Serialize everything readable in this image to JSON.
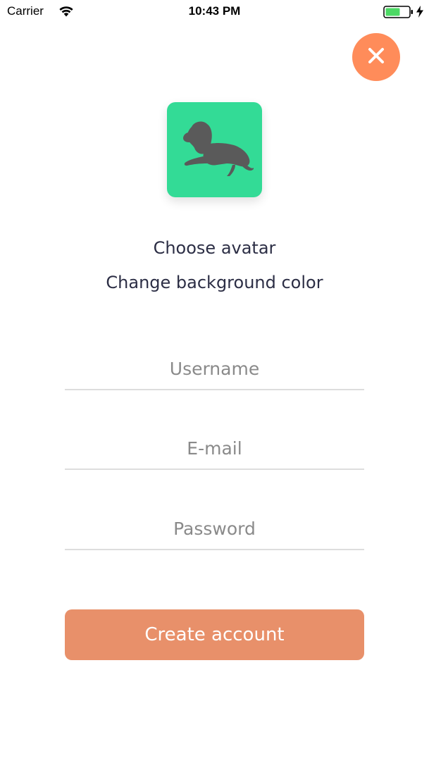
{
  "status_bar": {
    "carrier": "Carrier",
    "time": "10:43 PM",
    "icons": [
      "wifi-icon",
      "battery-icon",
      "charging-icon"
    ],
    "battery_color": "#4cd964"
  },
  "close": {
    "icon": "close-icon",
    "color": "#ff8c5a"
  },
  "avatar": {
    "icon": "lion-icon",
    "background_color": "#33db96",
    "figure_color": "#5a5a5a"
  },
  "links": {
    "choose_avatar": "Choose avatar",
    "change_background": "Change background color"
  },
  "form": {
    "username_placeholder": "Username",
    "username_value": "",
    "email_placeholder": "E-mail",
    "email_value": "",
    "password_placeholder": "Password",
    "password_value": ""
  },
  "submit": {
    "label": "Create account",
    "color": "#e8906a"
  }
}
